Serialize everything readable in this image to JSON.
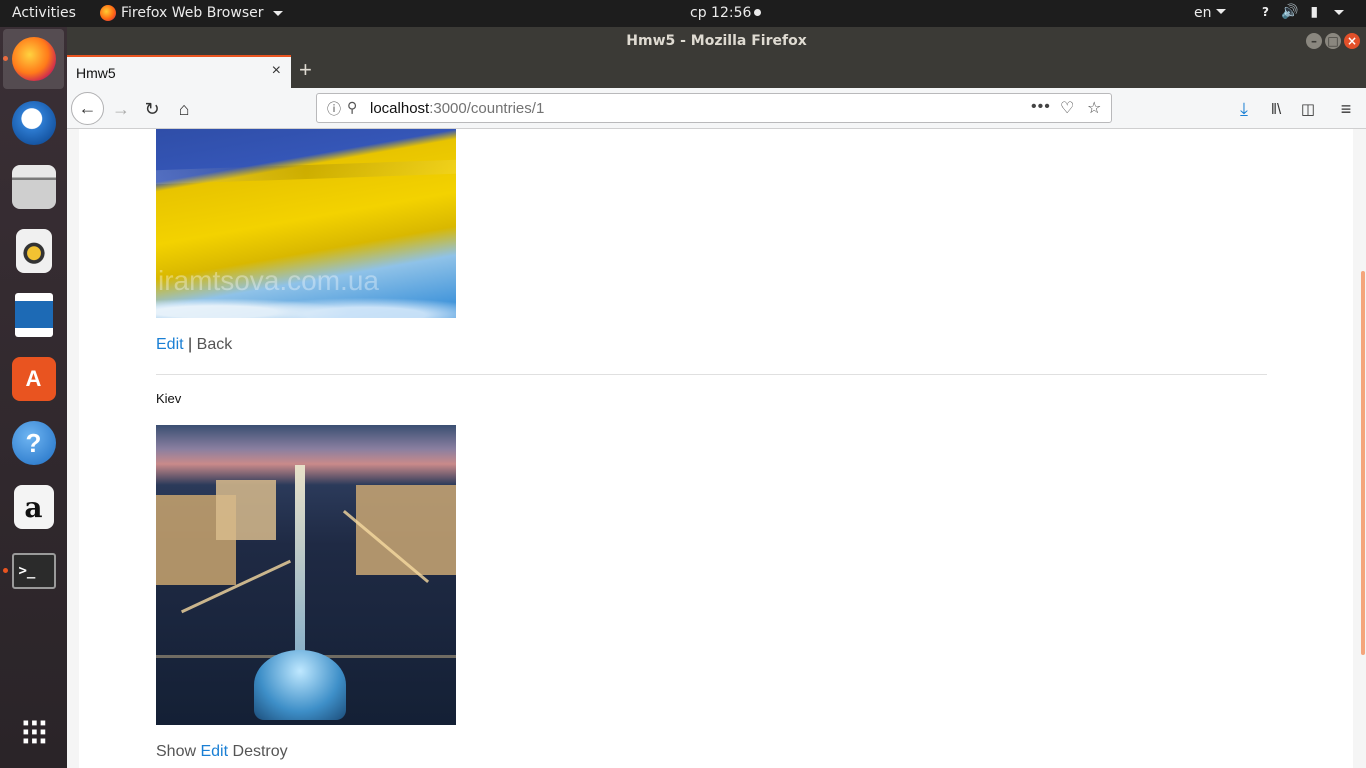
{
  "topbar": {
    "activities": "Activities",
    "app_menu": "Firefox Web Browser",
    "clock": "ср 12:56",
    "lang": "en"
  },
  "dock": {
    "items": [
      "Firefox",
      "Thunderbird",
      "Files",
      "Rhythmbox",
      "LibreOffice Writer",
      "Ubuntu Software",
      "Help",
      "Amazon",
      "Terminal",
      "Show Applications"
    ]
  },
  "window": {
    "title": "Hmw5 - Mozilla Firefox"
  },
  "tab": {
    "title": "Hmw5"
  },
  "urlbar": {
    "host": "localhost",
    "path": ":3000/countries/1"
  },
  "content": {
    "flag_watermark": "iramtsova.com.ua",
    "edit_link": "Edit",
    "separator": "|",
    "back_link": "Back",
    "city_name": "Kiev",
    "show_link": "Show",
    "city_edit_link": "Edit",
    "destroy_link": "Destroy"
  },
  "colors": {
    "link": "#1a7fd4",
    "accent": "#e95420"
  }
}
